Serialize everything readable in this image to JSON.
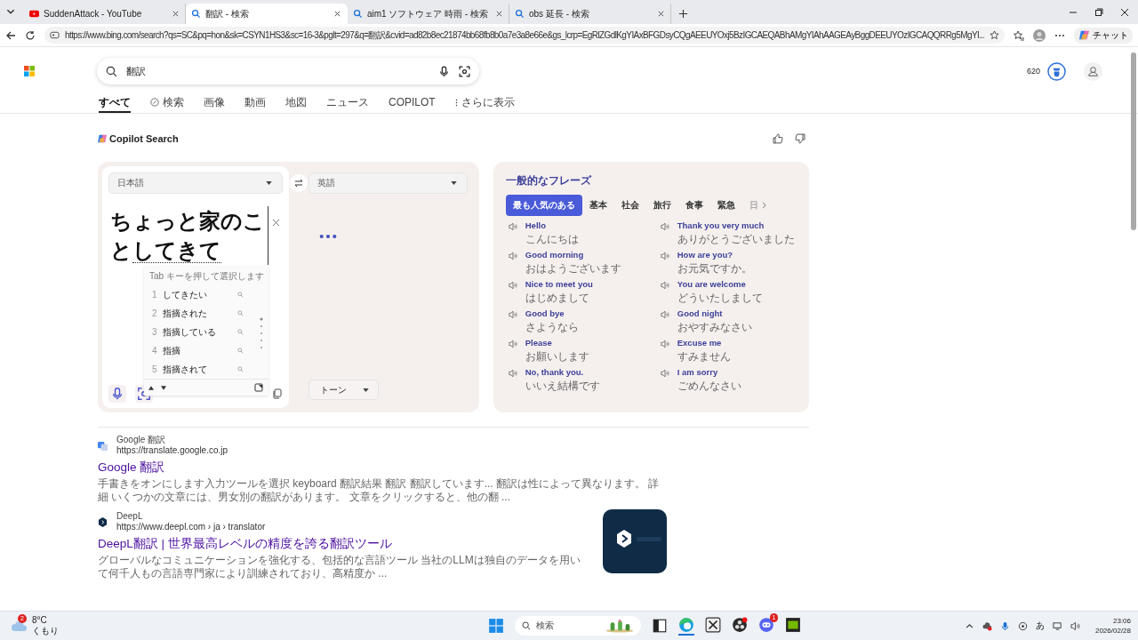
{
  "browser": {
    "tabs": [
      {
        "title": "SuddenAttack - YouTube",
        "kind": "video",
        "selected": false
      },
      {
        "title": "翻訳 - 検索",
        "kind": "search",
        "selected": true
      },
      {
        "title": "aim1 ソフトウェア 時雨 - 検索",
        "kind": "search",
        "selected": false
      },
      {
        "title": "obs 延長 - 検索",
        "kind": "search",
        "selected": false
      }
    ],
    "url": "https://www.bing.com/search?qs=SC&pq=hon&sk=CSYN1HS3&sc=16-3&pglt=297&q=翻訳&cvid=ad82b8ec21874bb68fb8b0a7e3a8e66e&gs_lcrp=EgRlZGdlKgYIAxBFGDsyCQgAEEUYOxj5BzIGCAEQABhAMgYIAhAAGEAyBggDEEUYOzIGCAQQRRg5MgYI...",
    "chat_label": "チャット"
  },
  "search": {
    "query": "翻訳",
    "points": "620",
    "nav": [
      {
        "label": "すべて",
        "kind": "plain",
        "selected": true
      },
      {
        "label": "検索",
        "kind": "copilot",
        "selected": false
      },
      {
        "label": "画像",
        "kind": "plain",
        "selected": false
      },
      {
        "label": "動画",
        "kind": "plain",
        "selected": false
      },
      {
        "label": "地図",
        "kind": "plain",
        "selected": false
      },
      {
        "label": "ニュース",
        "kind": "plain",
        "selected": false
      },
      {
        "label": "COPILOT",
        "kind": "plain",
        "selected": false
      },
      {
        "label": "さらに表示",
        "kind": "more",
        "selected": false
      }
    ]
  },
  "copilot": {
    "title": "Copilot Search"
  },
  "translator": {
    "source_language": "日本語",
    "target_language": "英語",
    "input_committed": "ちょっと家のこと",
    "input_composing": "してきて",
    "tone": "トーン",
    "ime": {
      "hint": "Tab キーを押して選択します",
      "candidates": [
        {
          "number": "1",
          "text": "してきたい"
        },
        {
          "number": "2",
          "text": "指摘された"
        },
        {
          "number": "3",
          "text": "指摘している"
        },
        {
          "number": "4",
          "text": "指摘"
        },
        {
          "number": "5",
          "text": "指摘されて"
        }
      ]
    }
  },
  "phrases": {
    "title": "一般的なフレーズ",
    "categories": [
      {
        "label": "最も人気のある",
        "selected": true
      },
      {
        "label": "基本",
        "selected": false
      },
      {
        "label": "社会",
        "selected": false
      },
      {
        "label": "旅行",
        "selected": false
      },
      {
        "label": "食事",
        "selected": false
      },
      {
        "label": "緊急",
        "selected": false
      },
      {
        "label": "日",
        "selected": false
      }
    ],
    "items": [
      {
        "en": "Hello",
        "ja": "こんにちは"
      },
      {
        "en": "Thank you very much",
        "ja": "ありがとうございました"
      },
      {
        "en": "Good morning",
        "ja": "おはようございます"
      },
      {
        "en": "How are you?",
        "ja": "お元気ですか。"
      },
      {
        "en": "Nice to meet you",
        "ja": "はじめまして"
      },
      {
        "en": "You are welcome",
        "ja": "どういたしまして"
      },
      {
        "en": "Good bye",
        "ja": "さようなら"
      },
      {
        "en": "Good night",
        "ja": "おやすみなさい"
      },
      {
        "en": "Please",
        "ja": "お願いします"
      },
      {
        "en": "Excuse me",
        "ja": "すみません"
      },
      {
        "en": "No, thank you.",
        "ja": "いいえ結構です"
      },
      {
        "en": "I am sorry",
        "ja": "ごめんなさい"
      }
    ]
  },
  "results": [
    {
      "kind": "google",
      "site": "Google 翻訳",
      "url": "https://translate.google.co.jp",
      "title": "Google 翻訳",
      "snippet": "手書きをオンにします入力ツールを選択 keyboard 翻訳結果 翻訳 翻訳しています... 翻訳は性によって異なります。 詳細 いくつかの文章には、男女別の翻訳があります。 文章をクリックすると、他の翻 ..."
    },
    {
      "kind": "deepl",
      "site": "DeepL",
      "url": "https://www.deepl.com › ja › translator",
      "title": "DeepL翻訳 | 世界最高レベルの精度を誇る翻訳ツール",
      "snippet": "グローバルなコミュニケーションを強化する、包括的な言語ツール 当社のLLMは独自のデータを用いて何千人もの言語専門家により訓練されており、高精度か ..."
    }
  ],
  "taskbar": {
    "weather_badge": "2",
    "temperature": "8°C",
    "condition": "くもり",
    "search": "検索",
    "discord_badge": "1",
    "ime_mode": "あ",
    "time": "23:06",
    "date": "2026/02/28"
  }
}
